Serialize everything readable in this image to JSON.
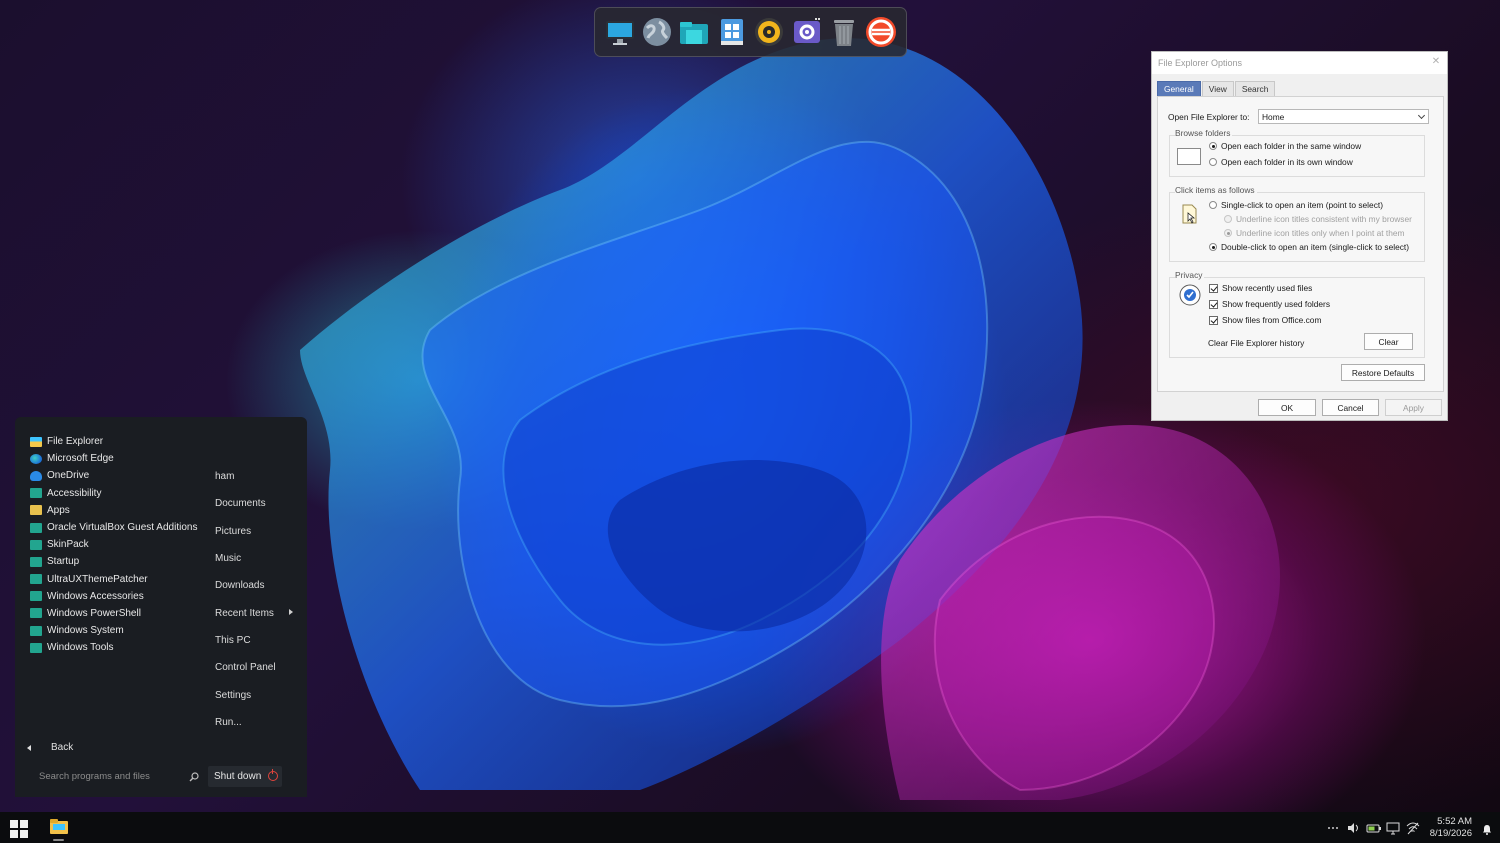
{
  "dock": {
    "icons": [
      "monitor-icon",
      "globe-icon",
      "file-explorer-icon",
      "installer-icon",
      "audio-player-icon",
      "settings-icon",
      "recycle-bin-icon",
      "sync-icon"
    ]
  },
  "start_menu": {
    "programs": [
      {
        "label": "File Explorer",
        "icon": "file-explorer-icon"
      },
      {
        "label": "Microsoft Edge",
        "icon": "edge-icon"
      },
      {
        "label": "OneDrive",
        "icon": "onedrive-icon"
      },
      {
        "label": "Accessibility",
        "icon": "folder-icon"
      },
      {
        "label": "Apps",
        "icon": "apps-icon"
      },
      {
        "label": "Oracle VirtualBox Guest Additions",
        "icon": "folder-icon"
      },
      {
        "label": "SkinPack",
        "icon": "folder-icon"
      },
      {
        "label": "Startup",
        "icon": "folder-icon"
      },
      {
        "label": "UltraUXThemePatcher",
        "icon": "folder-icon"
      },
      {
        "label": "Windows Accessories",
        "icon": "folder-icon"
      },
      {
        "label": "Windows PowerShell",
        "icon": "folder-icon"
      },
      {
        "label": "Windows System",
        "icon": "folder-icon"
      },
      {
        "label": "Windows Tools",
        "icon": "folder-icon"
      }
    ],
    "places": [
      "ham",
      "Documents",
      "Pictures",
      "Music",
      "Downloads",
      "Recent Items",
      "This PC",
      "Control Panel",
      "Settings",
      "Run..."
    ],
    "back_label": "Back",
    "search_placeholder": "Search programs and files",
    "shutdown_label": "Shut down"
  },
  "dialog": {
    "title": "File Explorer Options",
    "tabs": [
      "General",
      "View",
      "Search"
    ],
    "active_tab": "General",
    "open_label": "Open File Explorer to:",
    "open_value": "Home",
    "browse_group": "Browse folders",
    "browse_same": "Open each folder in the same window",
    "browse_own": "Open each folder in its own window",
    "click_group": "Click items as follows",
    "single_click": "Single-click to open an item (point to select)",
    "underline_browser": "Underline icon titles consistent with my browser",
    "underline_point": "Underline icon titles only when I point at them",
    "double_click": "Double-click to open an item (single-click to select)",
    "privacy_group": "Privacy",
    "recent_files": "Show recently used files",
    "frequent_folders": "Show frequently used folders",
    "office_files": "Show files from Office.com",
    "clear_history_label": "Clear File Explorer history",
    "clear_button": "Clear",
    "restore_button": "Restore Defaults",
    "ok_button": "OK",
    "cancel_button": "Cancel",
    "apply_button": "Apply"
  },
  "taskbar": {
    "time": "5:52 AM",
    "date": "8/19/2026",
    "tray_icons": [
      "overflow-icon",
      "volume-icon",
      "battery-icon",
      "display-icon",
      "network-icon"
    ]
  }
}
